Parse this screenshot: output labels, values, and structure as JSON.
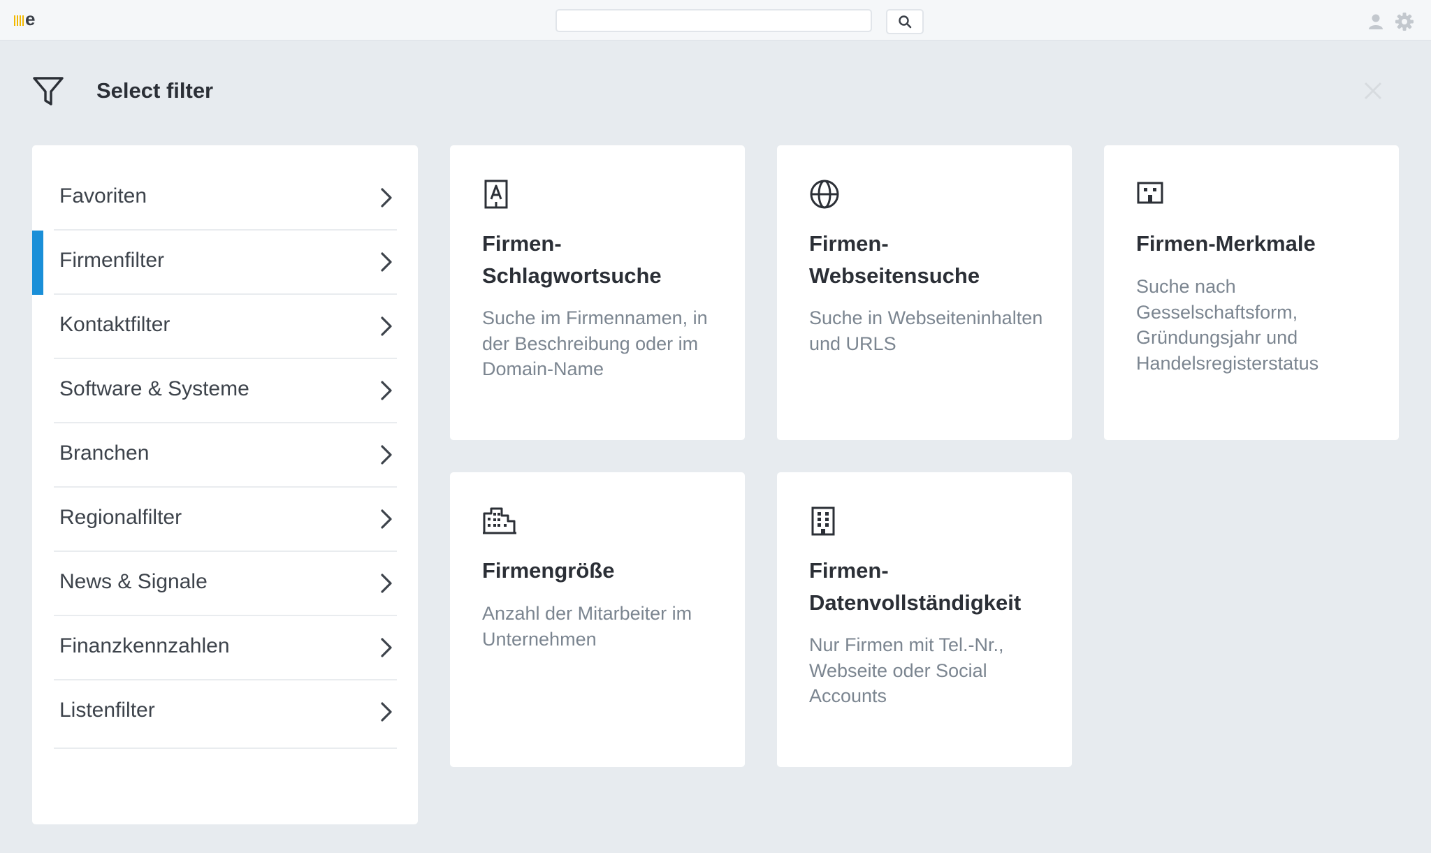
{
  "app": {
    "logo_letter": "e"
  },
  "topbar": {
    "search_placeholder": "",
    "search_value": ""
  },
  "header": {
    "title": "Select filter"
  },
  "sidebar": {
    "items": [
      {
        "label": "Favoriten"
      },
      {
        "label": "Firmenfilter",
        "active": true
      },
      {
        "label": "Kontaktfilter"
      },
      {
        "label": "Software & Systeme"
      },
      {
        "label": "Branchen"
      },
      {
        "label": "Regionalfilter"
      },
      {
        "label": "News & Signale"
      },
      {
        "label": "Finanzkennzahlen"
      },
      {
        "label": "Listenfilter"
      }
    ]
  },
  "cards": [
    {
      "icon": "building-letter-a-icon",
      "title": "Firmen-\nSchlagwortsuche",
      "description": "Suche im Firmennamen, in der Beschreibung oder im Domain-Name"
    },
    {
      "icon": "globe-icon",
      "title": "Firmen-\nWebseitensuche",
      "description": "Suche in Webseiteninhalten und URLS"
    },
    {
      "icon": "storefront-icon",
      "title": "Firmen-Merkmale",
      "description": "Suche nach Gesselschaftsform, Gründungsjahr und Handelsregisterstatus"
    },
    {
      "icon": "buildings-icon",
      "title": "Firmengröße",
      "description": "Anzahl der Mitarbeiter im Unternehmen"
    },
    {
      "icon": "office-building-icon",
      "title": "Firmen-\nDatenvollständigkeit",
      "description": "Nur Firmen mit Tel.-Nr., Webseite oder Social Accounts"
    }
  ],
  "colors": {
    "accent": "#1a8fd8",
    "logo_bars": "#f2b800",
    "background": "#e7ebef"
  }
}
